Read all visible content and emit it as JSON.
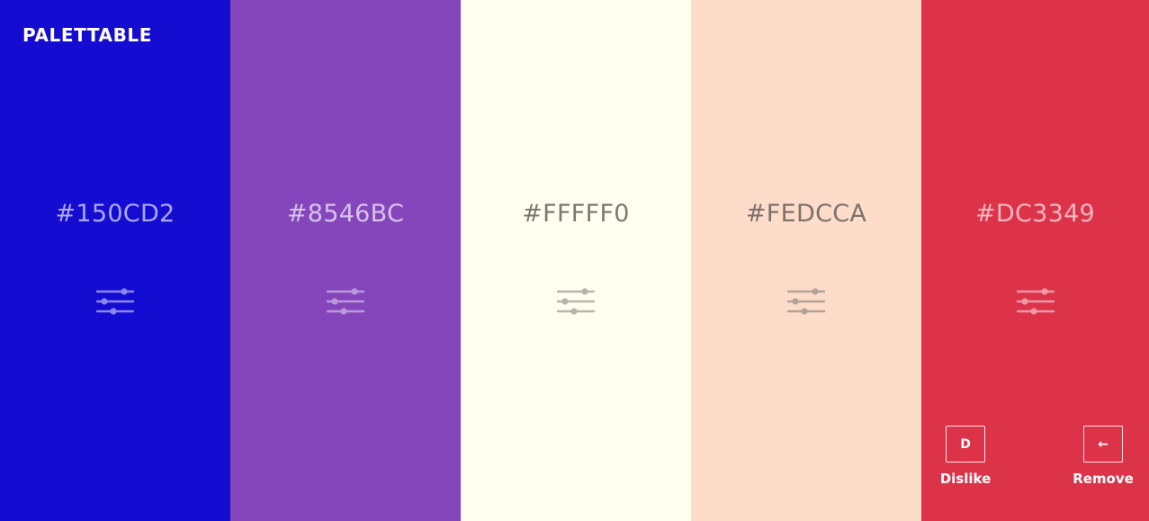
{
  "app": {
    "brand": "PALETTABLE"
  },
  "swatches": [
    {
      "hex": "#150CD2",
      "color": "#150CD2",
      "text_color": "#a9a8f0",
      "icon_color": "#8b87ec"
    },
    {
      "hex": "#8546BC",
      "color": "#8546BC",
      "text_color": "#d7c2ea",
      "icon_color": "#b99ad9"
    },
    {
      "hex": "#FFFFF0",
      "color": "#FFFFF0",
      "text_color": "#7a7a74",
      "icon_color": "#b6b6ac"
    },
    {
      "hex": "#FEDCCA",
      "color": "#FEDCCA",
      "text_color": "#7d726b",
      "icon_color": "#b3a298"
    },
    {
      "hex": "#DC3349",
      "color": "#DC3349",
      "text_color": "#f2b6be",
      "icon_color": "#ee9aa6"
    }
  ],
  "actions": {
    "dislike": {
      "key": "D",
      "label": "Dislike"
    },
    "remove": {
      "key": "←",
      "label": "Remove"
    }
  },
  "icons": {
    "adjust": "sliders-icon"
  }
}
